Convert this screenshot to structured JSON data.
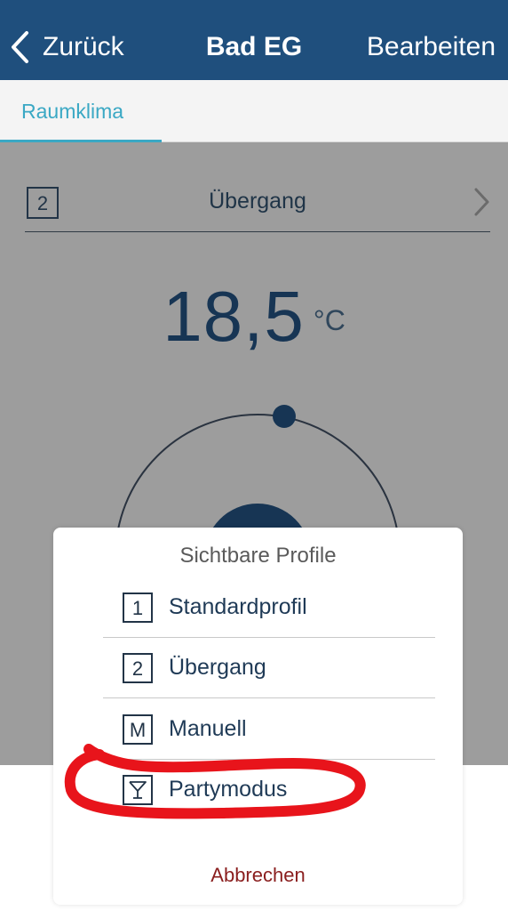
{
  "navbar": {
    "back_label": "Zurück",
    "title": "Bad EG",
    "edit_label": "Bearbeiten"
  },
  "tabs": [
    {
      "label": "Raumklima",
      "active": true
    }
  ],
  "active_profile": {
    "number": "2",
    "name": "Übergang"
  },
  "temperature": {
    "value": "18,5",
    "unit": "°C"
  },
  "modal": {
    "title": "Sichtbare Profile",
    "options": [
      {
        "icon_text": "1",
        "label": "Standardprofil"
      },
      {
        "icon_text": "2",
        "label": "Übergang"
      },
      {
        "icon_text": "M",
        "label": "Manuell"
      },
      {
        "icon": "cocktail-glass-icon",
        "label": "Partymodus"
      }
    ],
    "cancel_label": "Abbrechen"
  },
  "colors": {
    "navbar": "#1f4f7d",
    "tab_accent": "#3aa8c4",
    "dial_dark": "#173554",
    "cancel": "#8a1e1e",
    "annotation": "#e8141b"
  }
}
